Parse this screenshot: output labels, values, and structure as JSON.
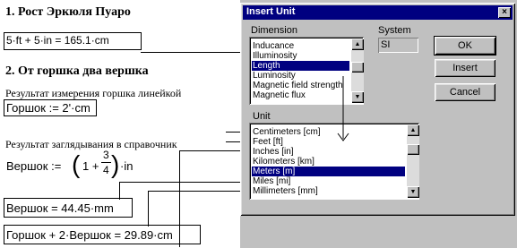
{
  "document": {
    "heading1": "1. Рост Эркюля Пуаро",
    "eq1": "5·ft + 5·in = 165.1·cm",
    "heading2": "2. От горшка два вершка",
    "text1": "Результат измерения горшка линейкой",
    "eq2": "Горшок := 2'·cm",
    "text2": "Результат заглядывания в справочник",
    "eq3_lhs": "Вершок :=",
    "eq3_paren_open": "(",
    "eq3_one": "1 +",
    "eq3_num": "3",
    "eq3_den": "4",
    "eq3_paren_close": ")",
    "eq3_unit": "·in",
    "eq4": "Вершок = 44.45·mm",
    "eq5": "Горшок + 2·Вершок = 29.89·cm"
  },
  "dialog": {
    "title": "Insert Unit",
    "close_label": "×",
    "dimension_label": "Dimension",
    "system_label": "System",
    "system_value": "SI",
    "dimension_items": [
      "Inducance",
      "Illuminosity",
      "Length",
      "Luminosity",
      "Magnetic field strength",
      "Magnetic flux"
    ],
    "dimension_selected_index": 2,
    "unit_label": "Unit",
    "unit_items": [
      "Centimeters [cm]",
      "Feet [ft]",
      "Inches [in]",
      "Kilometers [km]",
      "Meters [m]",
      "Miles [mi]",
      "Millimeters [mm]"
    ],
    "unit_selected_index": 4,
    "ok_label": "OK",
    "insert_label": "Insert",
    "cancel_label": "Cancel"
  }
}
